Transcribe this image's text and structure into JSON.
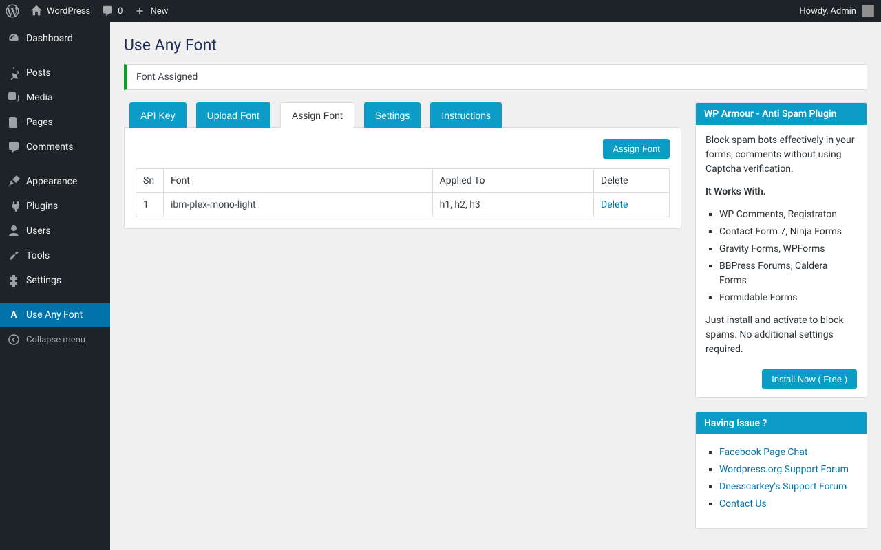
{
  "adminbar": {
    "site_name": "WordPress",
    "comments_count": "0",
    "new_label": "New",
    "howdy": "Howdy, Admin"
  },
  "sidebar": {
    "items": [
      {
        "label": "Dashboard"
      },
      {
        "label": "Posts"
      },
      {
        "label": "Media"
      },
      {
        "label": "Pages"
      },
      {
        "label": "Comments"
      },
      {
        "label": "Appearance"
      },
      {
        "label": "Plugins"
      },
      {
        "label": "Users"
      },
      {
        "label": "Tools"
      },
      {
        "label": "Settings"
      },
      {
        "label": "Use Any Font"
      }
    ],
    "collapse_label": "Collapse menu"
  },
  "page": {
    "title": "Use Any Font",
    "notice": "Font Assigned"
  },
  "tabs": {
    "api_key": "API Key",
    "upload_font": "Upload Font",
    "assign_font": "Assign Font",
    "settings": "Settings",
    "instructions": "Instructions"
  },
  "assign_panel": {
    "button": "Assign Font",
    "headers": {
      "sn": "Sn",
      "font": "Font",
      "applied": "Applied To",
      "delete": "Delete"
    },
    "rows": [
      {
        "sn": "1",
        "font": "ibm-plex-mono-light",
        "applied": "h1, h2, h3",
        "delete": "Delete"
      }
    ]
  },
  "sidebox1": {
    "title": "WP Armour - Anti Spam Plugin",
    "intro": "Block spam bots effectively in your forms, comments without using Captcha verification.",
    "works_label": "It Works With.",
    "works": [
      "WP Comments, Registraton",
      "Contact Form 7, Ninja Forms",
      "Gravity Forms, WPForms",
      "BBPress Forums, Caldera Forms",
      "Formidable Forms"
    ],
    "outro": "Just install and activate to block spams. No additional settings required.",
    "install_button": "Install Now ( Free )"
  },
  "sidebox2": {
    "title": "Having Issue ?",
    "links": [
      "Facebook Page Chat",
      "Wordpress.org Support Forum",
      "Dnesscarkey's Support Forum",
      "Contact Us"
    ]
  }
}
